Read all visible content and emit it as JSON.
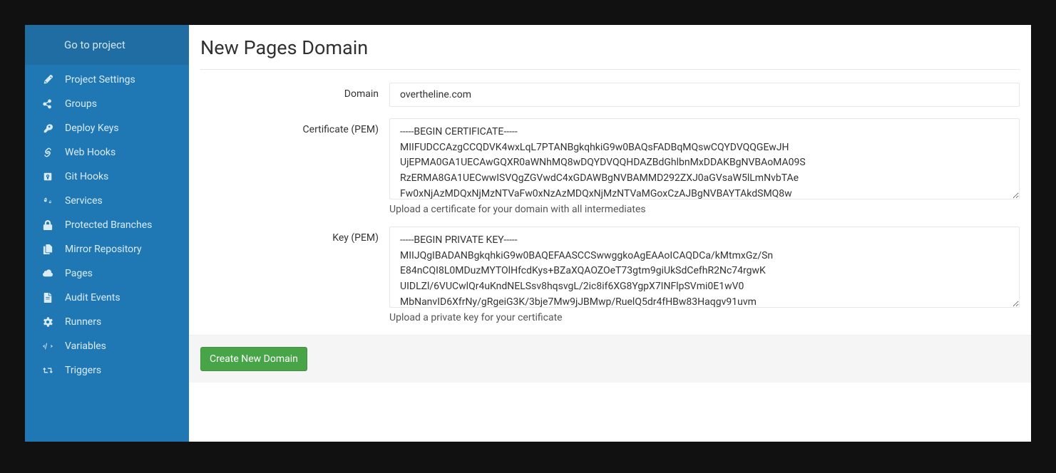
{
  "sidebar": {
    "top_link": "Go to project",
    "items": [
      {
        "icon": "edit-icon",
        "label": "Project Settings"
      },
      {
        "icon": "share-icon",
        "label": "Groups"
      },
      {
        "icon": "key-icon",
        "label": "Deploy Keys"
      },
      {
        "icon": "link-icon",
        "label": "Web Hooks"
      },
      {
        "icon": "git-icon",
        "label": "Git Hooks"
      },
      {
        "icon": "gears-icon",
        "label": "Services"
      },
      {
        "icon": "lock-icon",
        "label": "Protected Branches"
      },
      {
        "icon": "copy-icon",
        "label": "Mirror Repository"
      },
      {
        "icon": "cloud-icon",
        "label": "Pages"
      },
      {
        "icon": "file-icon",
        "label": "Audit Events"
      },
      {
        "icon": "gear-icon",
        "label": "Runners"
      },
      {
        "icon": "code-icon",
        "label": "Variables"
      },
      {
        "icon": "retweet-icon",
        "label": "Triggers"
      }
    ]
  },
  "main": {
    "title": "New Pages Domain",
    "form": {
      "domain_label": "Domain",
      "domain_value": "overtheline.com",
      "cert_label": "Certificate (PEM)",
      "cert_value": "-----BEGIN CERTIFICATE-----\nMIIFUDCCAzgCCQDVK4wxLqL7PTANBgkqhkiG9w0BAQsFADBqMQswCQYDVQQGEwJH\nUjEPMA0GA1UECAwGQXR0aWNhMQ8wDQYDVQQHDAZBdGhlbnMxDDAKBgNVBAoMA09S\nRzERMA8GA1UECwwISVQgZGVwdC4xGDAWBgNVBAMMD292ZXJ0aGVsaW5lLmNvbTAe\nFw0xNjAzMDQxNjMzNTVaFw0xNzAzMDQxNjMzNTVaMGoxCzAJBgNVBAYTAkdSMQ8w",
      "cert_help": "Upload a certificate for your domain with all intermediates",
      "key_label": "Key (PEM)",
      "key_value": "-----BEGIN PRIVATE KEY-----\nMIIJQgIBADANBgkqhkiG9w0BAQEFAASCCSwwggkoAgEAAoICAQDCa/kMtmxGz/Sn\nE84nCQI8L0MDuzMYTOlHfcdKys+BZaXQAOZOeT73gtm9giUkSdCefhR2Nc74rgwK\nUIDLZl/6VUCwlQr4uKndNELSsv8hqsvgL/2ic8if6XG8YgpX7INFlpSVmi0E1wV0\nMbNanvID6XfrNy/gRgeiG3K/3bje7Mw9jJBMwp/RuelQ5dr4fHBw83Haqgv91uvm",
      "key_help": "Upload a private key for your certificate"
    },
    "submit_label": "Create New Domain"
  }
}
